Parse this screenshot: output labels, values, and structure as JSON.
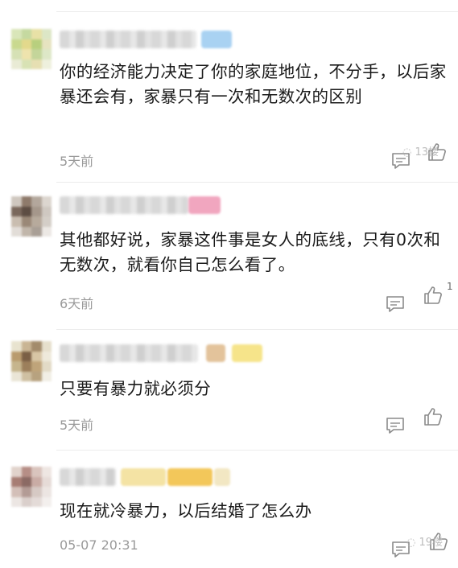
{
  "comments": [
    {
      "text": "你的经济能力决定了你的家庭地位，不分手，以后家暴还会有，家暴只有一次和无数次的区别",
      "time": "5天前",
      "likes": ""
    },
    {
      "text": "其他都好说，家暴这件事是女人的底线，只有0次和无数次，就看你自己怎么看了。",
      "time": "6天前",
      "likes": "1"
    },
    {
      "text": "只要有暴力就必须分",
      "time": "5天前",
      "likes": ""
    },
    {
      "text": "现在就冷暴力，以后结婚了怎么办",
      "time": "05-07 20:31",
      "likes": ""
    }
  ],
  "icons": {
    "reply": "comment-reply-icon",
    "like": "thumbs-up-icon"
  },
  "colors": {
    "text": "#1a1a1a",
    "meta": "#9a9a9a",
    "icon": "#8a8a8a"
  }
}
